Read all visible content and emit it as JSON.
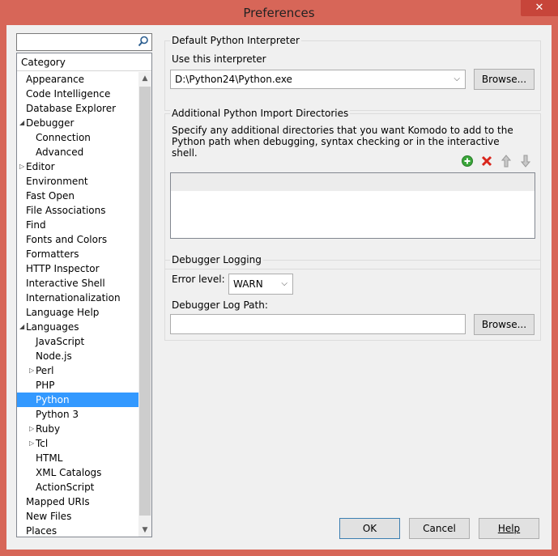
{
  "window": {
    "title": "Preferences",
    "close_glyph": "✕"
  },
  "search": {
    "value": "",
    "placeholder": ""
  },
  "tree": {
    "header": "Category",
    "items": [
      {
        "label": "Appearance",
        "level": 0,
        "toggle": ""
      },
      {
        "label": "Code Intelligence",
        "level": 0,
        "toggle": ""
      },
      {
        "label": "Database Explorer",
        "level": 0,
        "toggle": ""
      },
      {
        "label": "Debugger",
        "level": 0,
        "toggle": "expanded"
      },
      {
        "label": "Connection",
        "level": 1,
        "toggle": ""
      },
      {
        "label": "Advanced",
        "level": 1,
        "toggle": ""
      },
      {
        "label": "Editor",
        "level": 0,
        "toggle": "collapsed"
      },
      {
        "label": "Environment",
        "level": 0,
        "toggle": ""
      },
      {
        "label": "Fast Open",
        "level": 0,
        "toggle": ""
      },
      {
        "label": "File Associations",
        "level": 0,
        "toggle": ""
      },
      {
        "label": "Find",
        "level": 0,
        "toggle": ""
      },
      {
        "label": "Fonts and Colors",
        "level": 0,
        "toggle": ""
      },
      {
        "label": "Formatters",
        "level": 0,
        "toggle": ""
      },
      {
        "label": "HTTP Inspector",
        "level": 0,
        "toggle": ""
      },
      {
        "label": "Interactive Shell",
        "level": 0,
        "toggle": ""
      },
      {
        "label": "Internationalization",
        "level": 0,
        "toggle": ""
      },
      {
        "label": "Language Help",
        "level": 0,
        "toggle": ""
      },
      {
        "label": "Languages",
        "level": 0,
        "toggle": "expanded"
      },
      {
        "label": "JavaScript",
        "level": 1,
        "toggle": ""
      },
      {
        "label": "Node.js",
        "level": 1,
        "toggle": ""
      },
      {
        "label": "Perl",
        "level": 1,
        "toggle": "collapsed"
      },
      {
        "label": "PHP",
        "level": 1,
        "toggle": ""
      },
      {
        "label": "Python",
        "level": 1,
        "toggle": "",
        "selected": true
      },
      {
        "label": "Python 3",
        "level": 1,
        "toggle": ""
      },
      {
        "label": "Ruby",
        "level": 1,
        "toggle": "collapsed"
      },
      {
        "label": "Tcl",
        "level": 1,
        "toggle": "collapsed"
      },
      {
        "label": "HTML",
        "level": 1,
        "toggle": ""
      },
      {
        "label": "XML Catalogs",
        "level": 1,
        "toggle": ""
      },
      {
        "label": "ActionScript",
        "level": 1,
        "toggle": ""
      },
      {
        "label": "Mapped URIs",
        "level": 0,
        "toggle": ""
      },
      {
        "label": "New Files",
        "level": 0,
        "toggle": ""
      },
      {
        "label": "Places",
        "level": 0,
        "toggle": ""
      }
    ]
  },
  "interpreter": {
    "group_title": "Default Python Interpreter",
    "use_label": "Use this interpreter",
    "selected": "D:\\Python24\\Python.exe",
    "browse_label": "Browse..."
  },
  "import_dirs": {
    "group_title": "Additional Python Import Directories",
    "description": "Specify any additional directories that you want Komodo to add to the Python path when debugging, syntax checking or in the interactive shell."
  },
  "logging": {
    "group_title": "Debugger Logging",
    "error_level_label": "Error level:",
    "error_level_value": "WARN",
    "log_path_label": "Debugger Log Path:",
    "log_path_value": "",
    "browse_label": "Browse..."
  },
  "footer": {
    "ok_label": "OK",
    "cancel_label": "Cancel",
    "help_label": "Help"
  },
  "colors": {
    "frame": "#d76658",
    "selection": "#3399ff",
    "add_icon": "#3aa63a",
    "remove_icon": "#d9261c"
  }
}
